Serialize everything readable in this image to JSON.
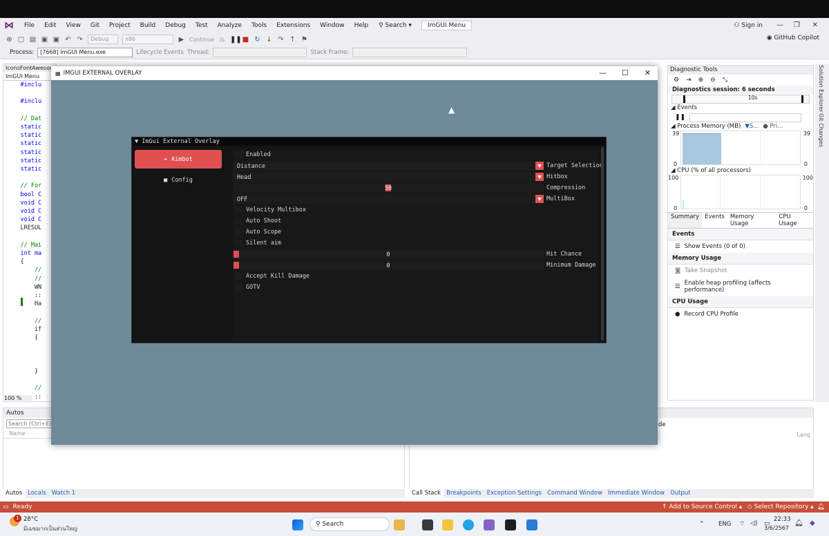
{
  "menu": {
    "items": [
      "File",
      "Edit",
      "View",
      "Git",
      "Project",
      "Build",
      "Debug",
      "Test",
      "Analyze",
      "Tools",
      "Extensions",
      "Window",
      "Help"
    ],
    "search": "Search",
    "solution_title": "ImGUI Menu",
    "sign_in": "Sign in",
    "copilot": "GitHub Copilot"
  },
  "toolbar": {
    "config": "Debug",
    "platform": "x86",
    "continue": "Continue"
  },
  "debugbar": {
    "process_label": "Process:",
    "process_value": "[7668] ImGUI Menu.exe",
    "lifecycle": "Lifecycle Events",
    "thread_label": "Thread:",
    "stack_label": "Stack Frame:"
  },
  "editor": {
    "file_tab": "IconsFontAwesome",
    "project_tab": "ImGUI Menu",
    "zoom": "100 %",
    "lines": [
      "    #inclu",
      "",
      "    #inclu",
      "",
      "    // Dat",
      "    static",
      "    static",
      "    static",
      "    static",
      "    static",
      "    static",
      "",
      "    // For",
      "    bool C",
      "    void C",
      "    void C",
      "    void C",
      "    LRESUL",
      "",
      "    // Mai",
      "    int ma",
      "    {",
      "        //",
      "        //",
      "        WN",
      "        ::",
      "        Ha",
      "",
      "        //",
      "        if",
      "        {",
      "",
      "",
      "",
      "        }",
      "",
      "        //",
      "        ::"
    ]
  },
  "autos": {
    "title": "Autos",
    "search_placeholder": "Search (Ctrl+E)",
    "col_name": "Name",
    "tabs": [
      "Autos",
      "Locals",
      "Watch 1"
    ]
  },
  "callstack": {
    "lang": "Lang",
    "col_fragment": "de",
    "tabs": [
      "Call Stack",
      "Breakpoints",
      "Exception Settings",
      "Command Window",
      "Immediate Window",
      "Output"
    ]
  },
  "diag": {
    "title": "Diagnostic Tools",
    "session": "Diagnostics session: 6 seconds",
    "tick_10s": "10s",
    "events_label": "Events",
    "memory_label": "Process Memory (MB)",
    "memory_legend_1": "S...",
    "memory_legend_2": "Pri...",
    "mem_max": "39",
    "mem_min": "0",
    "cpu_label": "CPU (% of all processors)",
    "cpu_max": "100",
    "cpu_min": "0",
    "tabs": [
      "Summary",
      "Events",
      "Memory Usage",
      "CPU Usage"
    ],
    "sec_events": "Events",
    "show_events": "Show Events (0 of 0)",
    "sec_memory": "Memory Usage",
    "snapshot": "Take Snapshot",
    "heap": "Enable heap profiling (affects performance)",
    "sec_cpu": "CPU Usage",
    "record_cpu": "Record CPU Profile"
  },
  "side_tabs": [
    "Solution Explorer",
    "Git Changes"
  ],
  "status": {
    "ready": "Ready",
    "source_control": "Add to Source Control",
    "repo": "Select Repository"
  },
  "taskbar": {
    "temp": "28°C",
    "weather": "มีเมฆมากเป็นส่วนใหญ่",
    "badge": "1",
    "search": "Search",
    "lang": "ENG",
    "time": "22:33",
    "date": "3/6/2567"
  },
  "overlay": {
    "window_title": "IMGUI EXTERNAL OVERLAY",
    "panel_title": "ImGui External Overlay",
    "nav_aimbot": "Aimbot",
    "nav_config": "Config",
    "enabled": "Enabled",
    "distance": "Distance",
    "target_selection": "Target Selection",
    "head": "Head",
    "hitbox": "Hitbox",
    "compression_value": "50",
    "compression": "Compression",
    "off": "OFF",
    "multibox": "MultiBox",
    "velocity_multibox": "Velocity Multibox",
    "auto_shoot": "Auto Shoot",
    "auto_scope": "Auto Scope",
    "silent_aim": "Silent aim",
    "hit_chance_value": "0",
    "hit_chance": "Hit Chance",
    "min_damage_value": "0",
    "min_damage": "Minimum Damage",
    "accept_kill": "Accept Kill Damage",
    "gotv": "GOTV",
    "accent": "#e05050"
  }
}
